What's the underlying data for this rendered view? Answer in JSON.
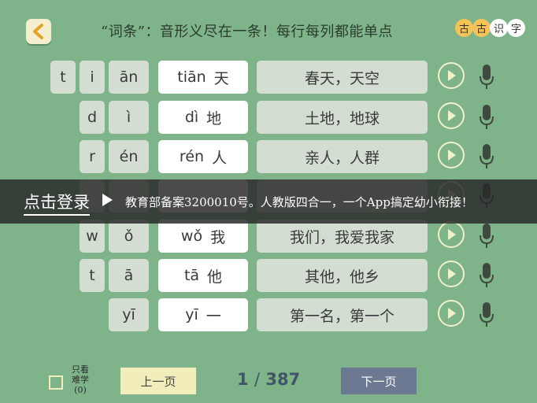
{
  "header": {
    "title": "“词条”：音形义尽在一条！每行每列都能单点",
    "brand": [
      "古",
      "古",
      "识",
      "字"
    ]
  },
  "rows": [
    {
      "initial": "t",
      "medial": "i",
      "final": "ān",
      "pinyin": "tiān",
      "hanzi": "天",
      "phrase": "春天，天空"
    },
    {
      "initial": "",
      "medial": "d",
      "final": "ì",
      "pinyin": "dì",
      "hanzi": "地",
      "phrase": "土地，地球"
    },
    {
      "initial": "",
      "medial": "r",
      "final": "én",
      "pinyin": "rén",
      "hanzi": "人",
      "phrase": "亲人，人群"
    },
    {
      "initial": "",
      "medial": "",
      "final": "",
      "pinyin": "",
      "hanzi": "",
      "phrase": ""
    },
    {
      "initial": "",
      "medial": "w",
      "final": "ǒ",
      "pinyin": "wǒ",
      "hanzi": "我",
      "phrase": "我们，我爱我家"
    },
    {
      "initial": "",
      "medial": "t",
      "final": "ā",
      "pinyin": "tā",
      "hanzi": "他",
      "phrase": "其他，他乡"
    },
    {
      "initial": "",
      "medial": "",
      "final": "yī",
      "pinyin": "yī",
      "hanzi": "一",
      "phrase": "第一名，第一个"
    }
  ],
  "banner": {
    "login": "点击登录",
    "notice": "教育部备案3200010号。人教版四合一，一个App搞定幼小衔接！"
  },
  "footer": {
    "filter_label": "只看难学(0)",
    "prev": "上一页",
    "page_current": "1",
    "page_sep": "/",
    "page_total": "387",
    "next": "下一页"
  },
  "colors": {
    "background": "#7fb38a",
    "cell": "#d3ddd2",
    "prev_button": "#f2eebc",
    "next_button": "#6d7892"
  }
}
